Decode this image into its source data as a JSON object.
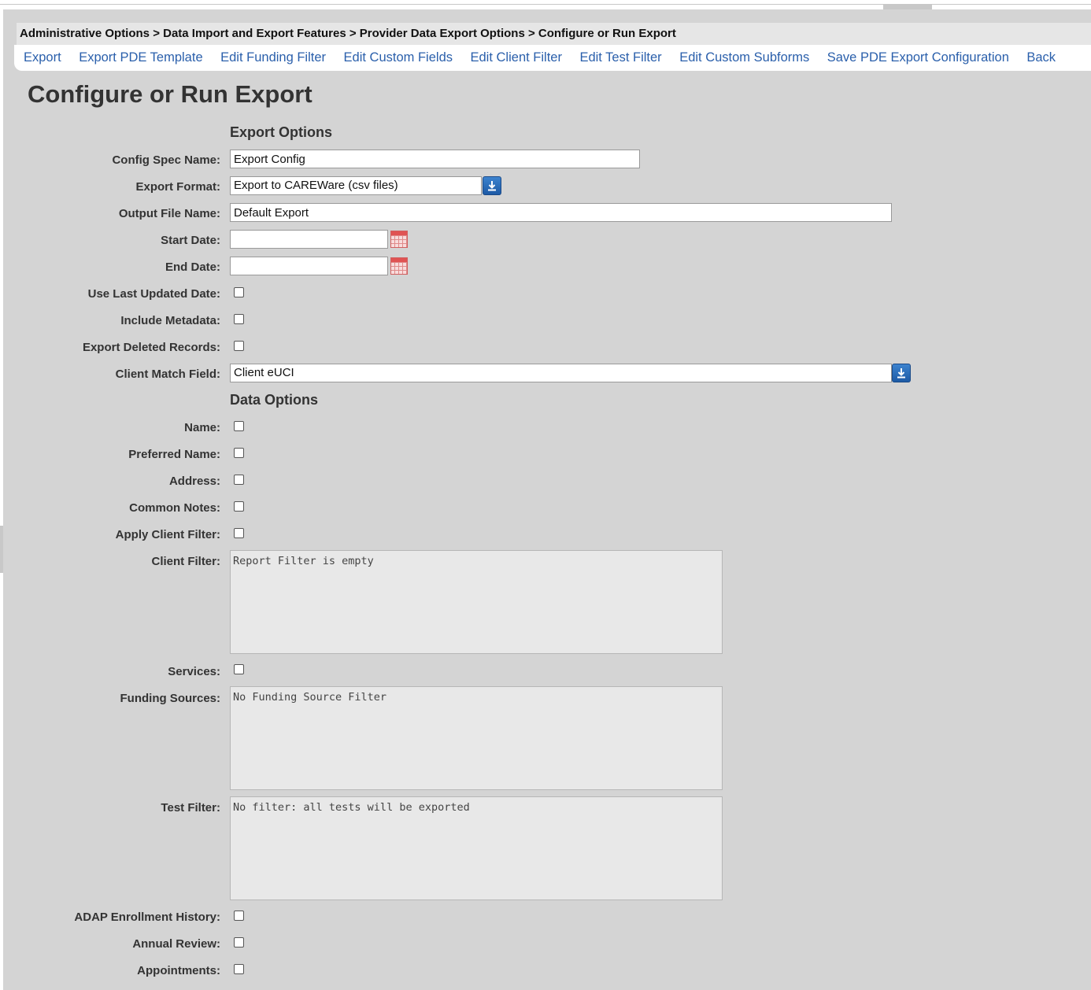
{
  "breadcrumb": "Administrative Options > Data Import and Export Features > Provider Data Export Options > Configure or Run Export",
  "menu": [
    "Export",
    "Export PDE Template",
    "Edit Funding Filter",
    "Edit Custom Fields",
    "Edit Client Filter",
    "Edit Test Filter",
    "Edit Custom Subforms",
    "Save PDE Export Configuration",
    "Back"
  ],
  "page_title": "Configure or Run Export",
  "export_options": {
    "heading": "Export Options",
    "config_spec_name": {
      "label": "Config Spec Name:",
      "value": "Export Config"
    },
    "export_format": {
      "label": "Export Format:",
      "value": "Export to CAREWare (csv files)"
    },
    "output_file_name": {
      "label": "Output File Name:",
      "value": "Default Export"
    },
    "start_date": {
      "label": "Start Date:",
      "value": ""
    },
    "end_date": {
      "label": "End Date:",
      "value": ""
    },
    "use_last_updated_date": {
      "label": "Use Last Updated Date:",
      "checked": false
    },
    "include_metadata": {
      "label": "Include Metadata:",
      "checked": false
    },
    "export_deleted_records": {
      "label": "Export Deleted Records:",
      "checked": false
    },
    "client_match_field": {
      "label": "Client Match Field:",
      "value": "Client eUCI"
    }
  },
  "data_options": {
    "heading": "Data Options",
    "name": {
      "label": "Name:",
      "checked": false
    },
    "preferred_name": {
      "label": "Preferred Name:",
      "checked": false
    },
    "address": {
      "label": "Address:",
      "checked": false
    },
    "common_notes": {
      "label": "Common Notes:",
      "checked": false
    },
    "apply_client_filter": {
      "label": "Apply Client Filter:",
      "checked": false
    },
    "client_filter": {
      "label": "Client Filter:",
      "value": "Report Filter is empty"
    },
    "services": {
      "label": "Services:",
      "checked": false
    },
    "funding_sources": {
      "label": "Funding Sources:",
      "value": "No Funding Source Filter"
    },
    "test_filter": {
      "label": "Test Filter:",
      "value": "No filter: all tests will be exported"
    },
    "adap_enrollment_history": {
      "label": "ADAP Enrollment History:",
      "checked": false
    },
    "annual_review": {
      "label": "Annual Review:",
      "checked": false
    },
    "appointments": {
      "label": "Appointments:",
      "checked": false
    }
  },
  "icons": {
    "dropdown": "download-arrow-icon",
    "calendar": "calendar-icon"
  },
  "colors": {
    "link": "#2a5fab",
    "background": "#d4d4d4",
    "dropdown_button": "#2a6fbe"
  }
}
